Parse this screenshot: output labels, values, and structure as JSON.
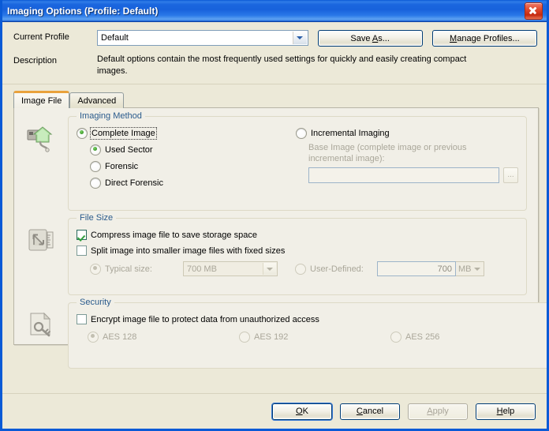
{
  "window": {
    "title": "Imaging Options (Profile: Default)",
    "close_label": "close-icon"
  },
  "header": {
    "profile_label": "Current Profile",
    "profile_value": "Default",
    "save_as_button": "Save As...",
    "save_as_accel": "A",
    "manage_profiles_button": "Manage Profiles...",
    "manage_profiles_accel": "M",
    "description_label": "Description",
    "description_text": "Default options contain the most frequently used settings for quickly and easily creating compact images."
  },
  "tabs": [
    {
      "label": "Image File",
      "active": true
    },
    {
      "label": "Advanced",
      "active": false
    }
  ],
  "imaging_method": {
    "title": "Imaging Method",
    "complete_image": "Complete Image",
    "used_sector": "Used Sector",
    "forensic": "Forensic",
    "direct_forensic": "Direct Forensic",
    "incremental_imaging": "Incremental Imaging",
    "base_image_label": "Base Image (complete image or previous incremental image):",
    "base_image_value": "",
    "browse_button": "..."
  },
  "file_size": {
    "title": "File Size",
    "compress_label": "Compress image file to save storage space",
    "split_label": "Split image into smaller image files with fixed sizes",
    "typical_label": "Typical size:",
    "typical_value": "700 MB",
    "user_defined_label": "User-Defined:",
    "user_defined_value": "700",
    "user_defined_unit": "MB"
  },
  "security": {
    "title": "Security",
    "encrypt_label": "Encrypt image file to protect data from unauthorized access",
    "aes128": "AES 128",
    "aes192": "AES 192",
    "aes256": "AES 256"
  },
  "footer": {
    "ok": "OK",
    "ok_accel": "O",
    "cancel": "Cancel",
    "cancel_accel": "C",
    "apply": "Apply",
    "apply_accel": "A",
    "help": "Help",
    "help_accel": "H"
  },
  "colors": {
    "title_blue": "#1862dc",
    "window_face": "#ece9d8",
    "panel_face": "#f1efe7",
    "group_title": "#2a5b8c",
    "tab_accent": "#e9a23c",
    "radio_green": "#3f9b2c",
    "check_green": "#2f9e3c",
    "disabled_text": "#aaa79a"
  }
}
